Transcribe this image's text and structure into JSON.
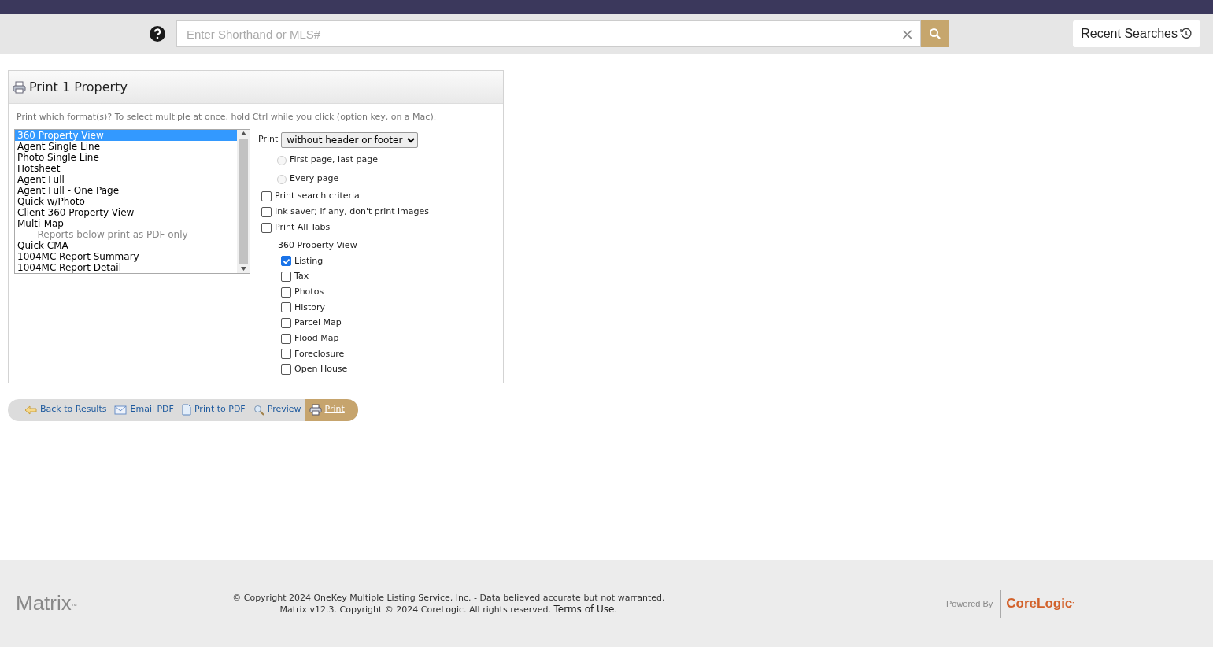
{
  "search_bar": {
    "placeholder": "Enter Shorthand or MLS#",
    "clear": "×",
    "recent_searches": "Recent Searches"
  },
  "panel": {
    "title": "Print 1 Property",
    "instructions": "Print which format(s)? To select multiple at once, hold Ctrl while you click (option key, on a Mac).",
    "formats": [
      {
        "label": "360 Property View",
        "kind": "option",
        "selected": true
      },
      {
        "label": "Agent Single Line",
        "kind": "option",
        "selected": false
      },
      {
        "label": "Photo Single Line",
        "kind": "option",
        "selected": false
      },
      {
        "label": "Hotsheet",
        "kind": "option",
        "selected": false
      },
      {
        "label": "Agent Full",
        "kind": "option",
        "selected": false
      },
      {
        "label": "Agent Full - One Page",
        "kind": "option",
        "selected": false
      },
      {
        "label": "Quick w/Photo",
        "kind": "option",
        "selected": false
      },
      {
        "label": "Client 360 Property View",
        "kind": "option",
        "selected": false
      },
      {
        "label": "Multi-Map",
        "kind": "option",
        "selected": false
      },
      {
        "label": "----- Reports below print as PDF only -----",
        "kind": "separator",
        "selected": false
      },
      {
        "label": "Quick CMA",
        "kind": "option",
        "selected": false
      },
      {
        "label": "1004MC Report Summary",
        "kind": "option",
        "selected": false
      },
      {
        "label": "1004MC Report Detail",
        "kind": "option",
        "selected": false
      }
    ],
    "print_label": "Print",
    "print_select": "without header or footer",
    "page_options": [
      {
        "label": "First page, last page",
        "selected": false
      },
      {
        "label": "Every page",
        "selected": false
      }
    ],
    "options": [
      {
        "label": "Print search criteria",
        "checked": false
      },
      {
        "label": "Ink saver; if any, don't print images",
        "checked": false
      },
      {
        "label": "Print All Tabs",
        "checked": false
      }
    ],
    "tabs_title": "360 Property View",
    "tabs": [
      {
        "label": "Listing",
        "checked": true
      },
      {
        "label": "Tax",
        "checked": false
      },
      {
        "label": "Photos",
        "checked": false
      },
      {
        "label": "History",
        "checked": false
      },
      {
        "label": "Parcel Map",
        "checked": false
      },
      {
        "label": "Flood Map",
        "checked": false
      },
      {
        "label": "Foreclosure",
        "checked": false
      },
      {
        "label": "Open House",
        "checked": false
      }
    ]
  },
  "actions": [
    {
      "label": "Back to Results",
      "kind": "back",
      "selected": false
    },
    {
      "label": "Email PDF",
      "kind": "email",
      "selected": false
    },
    {
      "label": "Print to PDF",
      "kind": "pdf",
      "selected": false
    },
    {
      "label": "Preview",
      "kind": "preview",
      "selected": false
    },
    {
      "label": "Print",
      "kind": "print",
      "selected": true
    }
  ],
  "footer": {
    "logo": "Matrix",
    "logo_mark": "™",
    "copyright": "© Copyright 2024 OneKey Multiple Listing Service, Inc. - Data believed accurate but not warranted.",
    "version": "Matrix v12.3. Copyright © 2024 CoreLogic. All rights reserved.",
    "terms": "Terms of Use.",
    "powered_by": "Powered By",
    "brand": "CoreLogic",
    "brand_mark": "·"
  }
}
